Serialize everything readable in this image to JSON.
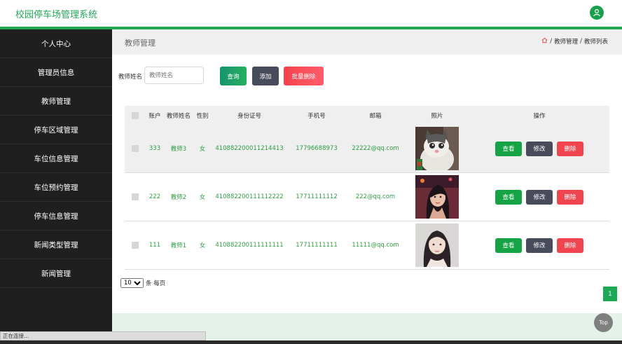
{
  "app": {
    "title": "校园停车场管理系统"
  },
  "sidebar": {
    "items": [
      {
        "label": "个人中心"
      },
      {
        "label": "管理员信息"
      },
      {
        "label": "教师管理"
      },
      {
        "label": "停车区域管理"
      },
      {
        "label": "车位信息管理"
      },
      {
        "label": "车位预约管理"
      },
      {
        "label": "停车信息管理"
      },
      {
        "label": "新闻类型管理"
      },
      {
        "label": "新闻管理"
      }
    ]
  },
  "page": {
    "title": "教师管理",
    "breadcrumb": [
      "教师管理",
      "/",
      "教师列表"
    ],
    "breadcrumb_sep": "/"
  },
  "search": {
    "label": "教师姓名",
    "placeholder": "教师姓名",
    "query_label": "查询",
    "add_label": "添加",
    "batch_delete_label": "批量删除"
  },
  "table": {
    "columns": [
      "账户",
      "教师姓名",
      "性别",
      "身份证号",
      "手机号",
      "邮箱",
      "照片",
      "操作"
    ],
    "rows": [
      {
        "account": "333",
        "name": "教师3",
        "sex": "女",
        "id_no": "410882200011214413",
        "phone": "17796688973",
        "email": "22222@qq.com",
        "photo": "cat"
      },
      {
        "account": "222",
        "name": "教师2",
        "sex": "女",
        "id_no": "410882200111112222",
        "phone": "17711111112",
        "email": "222@qq.com",
        "photo": "woman-red"
      },
      {
        "account": "111",
        "name": "教师1",
        "sex": "女",
        "id_no": "410882200111111111",
        "phone": "17711111111",
        "email": "11111@qq.com",
        "photo": "woman-light"
      }
    ],
    "actions": {
      "view": "查看",
      "edit": "修改",
      "delete": "删除"
    }
  },
  "pagination": {
    "page_size": "10",
    "page_size_suffix": "条 每页",
    "current_page": "1"
  },
  "top_button": "Top",
  "status_text": "正在连接...",
  "colors": {
    "accent": "#1ea854",
    "sidebar_bg": "#1f1f1f",
    "danger": "#f0444e",
    "dark_button": "#474b5a"
  }
}
